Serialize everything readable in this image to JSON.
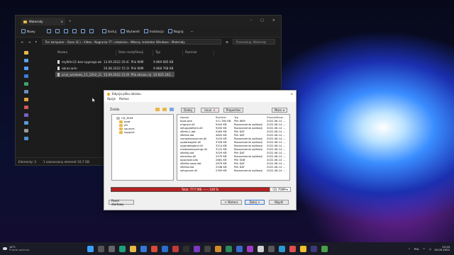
{
  "explorer": {
    "tab_title": "Materiały",
    "toolbar": {
      "new": "Nowy",
      "sort": "Sortuj",
      "view": "Wyświetl",
      "install": "Instalacja",
      "burn": "Nagraj"
    },
    "address": "Ten komputer › Dane (E:) › Video › Nagrania YT i szkolenia › Własny instalator Windows › Materiały",
    "search_placeholder": "Przeszukaj: Materiały",
    "columns": [
      "Nazwa",
      "Data modyfikacji",
      "Typ",
      "Rozmiar"
    ],
    "files": [
      {
        "name": "myWim11-bez-sygnega.wim",
        "date": "13.09.2022 20:41",
        "type": "Plik WIM",
        "size": "9 869 685 KB"
      },
      {
        "name": "obraz.wim",
        "date": "20.08.2022 15:16",
        "type": "Plik WIM",
        "size": "9 868 768 KB"
      },
      {
        "name": "pl-pl_windows_11_22h2_22621_4_multi_x...",
        "date": "15.09.2022 21:00",
        "type": "Plik obrazu dysku",
        "size": "10 825 242..."
      }
    ],
    "status": {
      "count": "Elementy: 3",
      "selected": "1 zaznaczony element 10,7 GB"
    }
  },
  "dialog": {
    "title": "Edycja pliku obrazu",
    "menu": [
      "Opcje",
      "Pomoc"
    ],
    "source_label": "Źródło",
    "buttons": {
      "add": "Dodaj",
      "delete": "Usuń",
      "properties": "Properties",
      "more": "More"
    },
    "tree": [
      "CD_ROM",
      "boot",
      "efi",
      "sources",
      "support"
    ],
    "list_columns": [
      "Nazwa",
      "Rozmiar",
      "Typ",
      "Zmodyfikow..."
    ],
    "list": [
      [
        "boot.wim",
        "511 260 KB",
        "Plik WIM",
        "2022-06-14 ..."
      ],
      [
        "migcore.dll",
        "9404 KB",
        "Rozszerzenie aplikacji",
        "2022-06-14 ..."
      ],
      [
        "setupplatform.dll",
        "9450 KB",
        "Rozszerzenie aplikacji",
        "2022-06-14 ..."
      ],
      [
        "sflefnc1.dat",
        "5463 KB",
        "Plik DAT",
        "2022-06-14 ..."
      ],
      [
        "sflefvd.dat",
        "4820 KB",
        "Plik DAT",
        "2022-06-14 ..."
      ],
      [
        "compatresources.dll",
        "3434 KB",
        "Rozszerzenie aplikacji",
        "2022-06-14 ..."
      ],
      [
        "updateagent.dll",
        "3326 KB",
        "Rozszerzenie aplikacji",
        "2022-06-14 ..."
      ],
      [
        "upgradeagent.dll",
        "3214 KB",
        "Rozszerzenie aplikacji",
        "2022-06-14 ..."
      ],
      [
        "mediasetupuimgr.dll",
        "3122 KB",
        "Rozszerzenie aplikacji",
        "2022-06-14 ..."
      ],
      [
        "sflefsb.dat",
        "3029 KB",
        "Plik DAT",
        "2022-06-14 ..."
      ],
      [
        "winsetup.dll",
        "2979 KB",
        "Rozszerzenie aplikacji",
        "2022-06-14 ..."
      ],
      [
        "appraiser.sdb",
        "2881 KB",
        "Plik SDB",
        "2022-06-14 ..."
      ],
      [
        "sfleftxt.sosa.dat",
        "2879 KB",
        "Plik DAT",
        "2022-06-14 ..."
      ],
      [
        "sflefsd.dat",
        "2548 KB",
        "Plik DAT",
        "2022-06-14 ..."
      ],
      [
        "setupcore.dll",
        "2359 KB",
        "Rozszerzenie aplikacji",
        "2022-06-14 ..."
      ]
    ],
    "capacity": {
      "label": "Bootable Image",
      "total": "Total: 7??? MB  ------  100 %",
      "media": "CD 700M"
    },
    "footer": {
      "start": "Panel startowy",
      "back": "< Wstecz",
      "next": "Dalej >",
      "exit": "Wyjdź"
    }
  },
  "taskbar": {
    "weather_temp": "14°C",
    "weather_text": "Prawie zachmur.",
    "lang": "POL",
    "time": "15:19",
    "date": "20.09.2022"
  }
}
